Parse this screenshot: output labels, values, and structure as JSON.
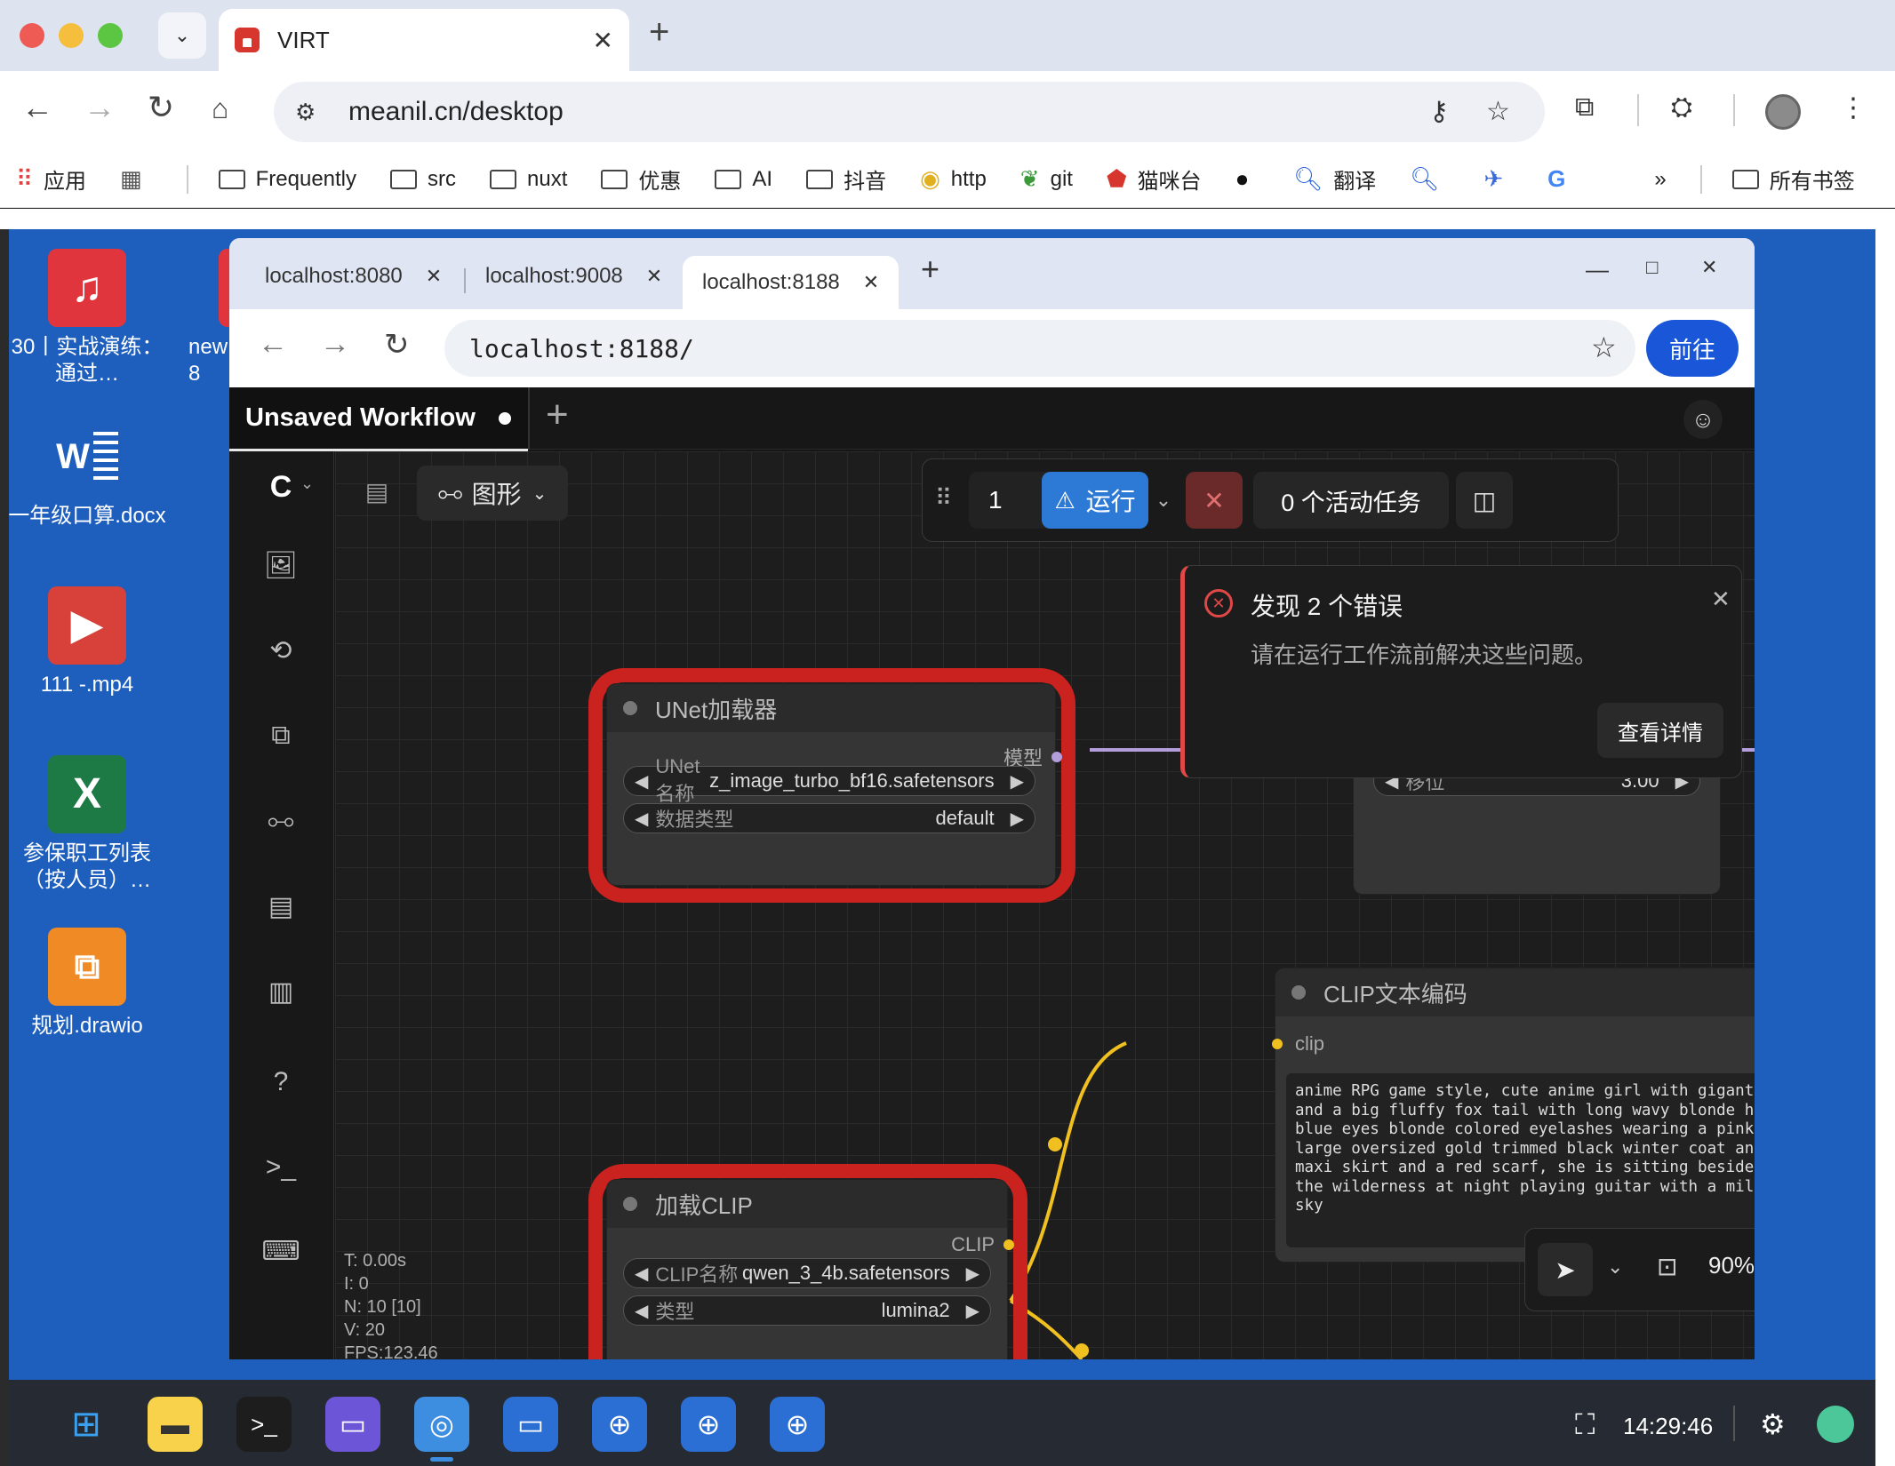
{
  "outer_browser": {
    "tab_title": "VIRT",
    "tab_close": "✕",
    "new_tab": "+",
    "url": "meanil.cn/desktop",
    "bookmarks": [
      {
        "label": "应用",
        "icon": "apps-grid-icon"
      },
      {
        "label": "",
        "icon": "tab-groups-icon"
      },
      {
        "label": "Frequently",
        "icon": "folder-icon"
      },
      {
        "label": "src",
        "icon": "folder-icon"
      },
      {
        "label": "nuxt",
        "icon": "folder-icon"
      },
      {
        "label": "优惠",
        "icon": "folder-icon"
      },
      {
        "label": "AI",
        "icon": "folder-icon"
      },
      {
        "label": "抖音",
        "icon": "folder-icon"
      },
      {
        "label": "http",
        "icon": "owl-icon"
      },
      {
        "label": "git",
        "icon": "leaf-icon"
      },
      {
        "label": "猫咪台",
        "icon": "house-icon"
      },
      {
        "label": "",
        "icon": "github-icon"
      },
      {
        "label": "翻译",
        "icon": "search-icon"
      },
      {
        "label": "",
        "icon": "search-icon"
      },
      {
        "label": "",
        "icon": "bird-icon"
      },
      {
        "label": "",
        "icon": "google-icon"
      }
    ],
    "bookmarks_more": "»",
    "all_bookmarks": "所有书签"
  },
  "desktop": {
    "icons": [
      {
        "label": "30丨实战演练：通过…",
        "type": "music-file-icon",
        "color": "#e0353d"
      },
      {
        "label": "new 8",
        "type": "file-icon",
        "color": "#e0353d"
      },
      {
        "label": "一年级口算.docx",
        "type": "word-doc-icon",
        "color": "#2b5fb8"
      },
      {
        "label": "111 -.mp4",
        "type": "video-file-icon",
        "color": "#d8413a"
      },
      {
        "label": "参保职工列表（按人员）…",
        "type": "excel-file-icon",
        "color": "#1e7a45"
      },
      {
        "label": "规划.drawio",
        "type": "drawio-icon",
        "color": "#f08a24"
      }
    ],
    "icon_glyphs": {
      "music": "♫",
      "word": "W",
      "video": "▶",
      "excel": "X"
    }
  },
  "taskbar": {
    "clock": "14:29:46",
    "apps": [
      "windows-start-icon",
      "file-manager-icon",
      "terminal-icon",
      "app-window-icon",
      "browser-icon",
      "remote-desktop-icon",
      "globe-icon",
      "globe-icon",
      "globe-icon"
    ]
  },
  "inner_browser": {
    "tabs": [
      {
        "label": "localhost:8080",
        "active": false
      },
      {
        "label": "localhost:9008",
        "active": false
      },
      {
        "label": "localhost:8188",
        "active": true
      }
    ],
    "tab_close": "✕",
    "new_tab": "+",
    "url": "localhost:8188/",
    "go_button": "前往",
    "window_controls": {
      "minimize": "—",
      "maximize": "□",
      "close": "✕"
    }
  },
  "comfy": {
    "workflow_tab": "Unsaved Workflow",
    "new_workflow": "+",
    "graph_mode": "图形",
    "queue_count": "1",
    "run_label": "运行",
    "active_tasks": "0 个活动任务",
    "error_toast": {
      "title": "发现 2 个错误",
      "message": "请在运行工作流前解决这些问题。",
      "details_button": "查看详情",
      "close": "✕"
    },
    "nodes": {
      "unet_loader": {
        "title": "UNet加载器",
        "output": "模型",
        "widgets": [
          {
            "label": "UNet名称",
            "value": "z_image_turbo_bf16.safetensors"
          },
          {
            "label": "数据类型",
            "value": "default"
          }
        ]
      },
      "partial_node": {
        "widgets": [
          {
            "label": "移位",
            "value": "3.00"
          }
        ]
      },
      "clip_text_encode": {
        "title": "CLIP文本编码",
        "input": "clip",
        "text": "anime RPG game style, cute anime girl with gigantic fennec\nand a big fluffy fox tail with long wavy blonde hair and la\nblue eyes blonde colored eyelashes wearing a pink sweater a\nlarge oversized gold trimmed black winter coat and a long b\nmaxi skirt and a red scarf, she is sitting beside a campfir\nthe wilderness at night playing guitar with a milky way gal\nsky"
      },
      "load_clip": {
        "title": "加载CLIP",
        "output": "CLIP",
        "widgets": [
          {
            "label": "CLIP名称",
            "value": "qwen_3_4b.safetensors"
          },
          {
            "label": "类型",
            "value": "lumina2"
          }
        ]
      }
    },
    "stats": {
      "t": "T: 0.00s",
      "i": "I: 0",
      "n": "N: 10 [10]",
      "v": "V: 20",
      "fps": "FPS:123.46"
    },
    "zoom": "90%",
    "colors": {
      "run_button": "#2d7ad6",
      "error_accent": "#e04848",
      "highlight_box": "#c9221f",
      "clip_link": "#f0c020",
      "model_link": "#b39ddb"
    }
  }
}
